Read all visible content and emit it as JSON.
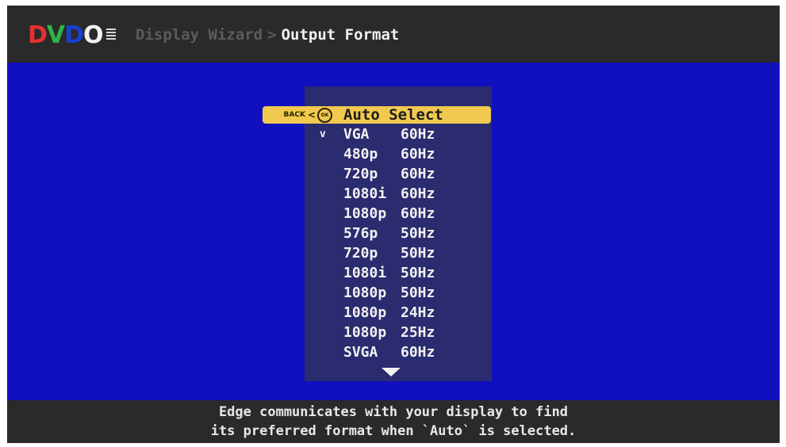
{
  "logo": {
    "letters": [
      {
        "char": "D",
        "color": "#e53030"
      },
      {
        "char": "V",
        "color": "#2fb34a"
      },
      {
        "char": "D",
        "color": "#1a3fd6"
      },
      {
        "char": "O",
        "color": "#f2f2f2"
      }
    ]
  },
  "header": {
    "breadcrumb_parent": "Display Wizard",
    "breadcrumb_separator": ">",
    "breadcrumb_current": "Output Format"
  },
  "menu": {
    "back_label": "BACK",
    "back_arrow": "<",
    "ok_label": "OK",
    "selected_item": "Auto Select",
    "items": [
      {
        "res": "VGA",
        "rate": "60Hz",
        "checked": true
      },
      {
        "res": "480p",
        "rate": "60Hz",
        "checked": false
      },
      {
        "res": "720p",
        "rate": "60Hz",
        "checked": false
      },
      {
        "res": "1080i",
        "rate": "60Hz",
        "checked": false
      },
      {
        "res": "1080p",
        "rate": "60Hz",
        "checked": false
      },
      {
        "res": "576p",
        "rate": "50Hz",
        "checked": false
      },
      {
        "res": "720p",
        "rate": "50Hz",
        "checked": false
      },
      {
        "res": "1080i",
        "rate": "50Hz",
        "checked": false
      },
      {
        "res": "1080p",
        "rate": "50Hz",
        "checked": false
      },
      {
        "res": "1080p",
        "rate": "24Hz",
        "checked": false
      },
      {
        "res": "1080p",
        "rate": "25Hz",
        "checked": false
      },
      {
        "res": "SVGA",
        "rate": "60Hz",
        "checked": false
      }
    ],
    "checkmark_glyph": "v"
  },
  "footer": {
    "line1": "Edge communicates with your display to find",
    "line2": "its preferred format when `Auto` is selected."
  },
  "colors": {
    "background": "#1010bf",
    "highlight": "#f1c94e",
    "panel": "#2b2b6f",
    "bar": "#2a2a2a"
  }
}
